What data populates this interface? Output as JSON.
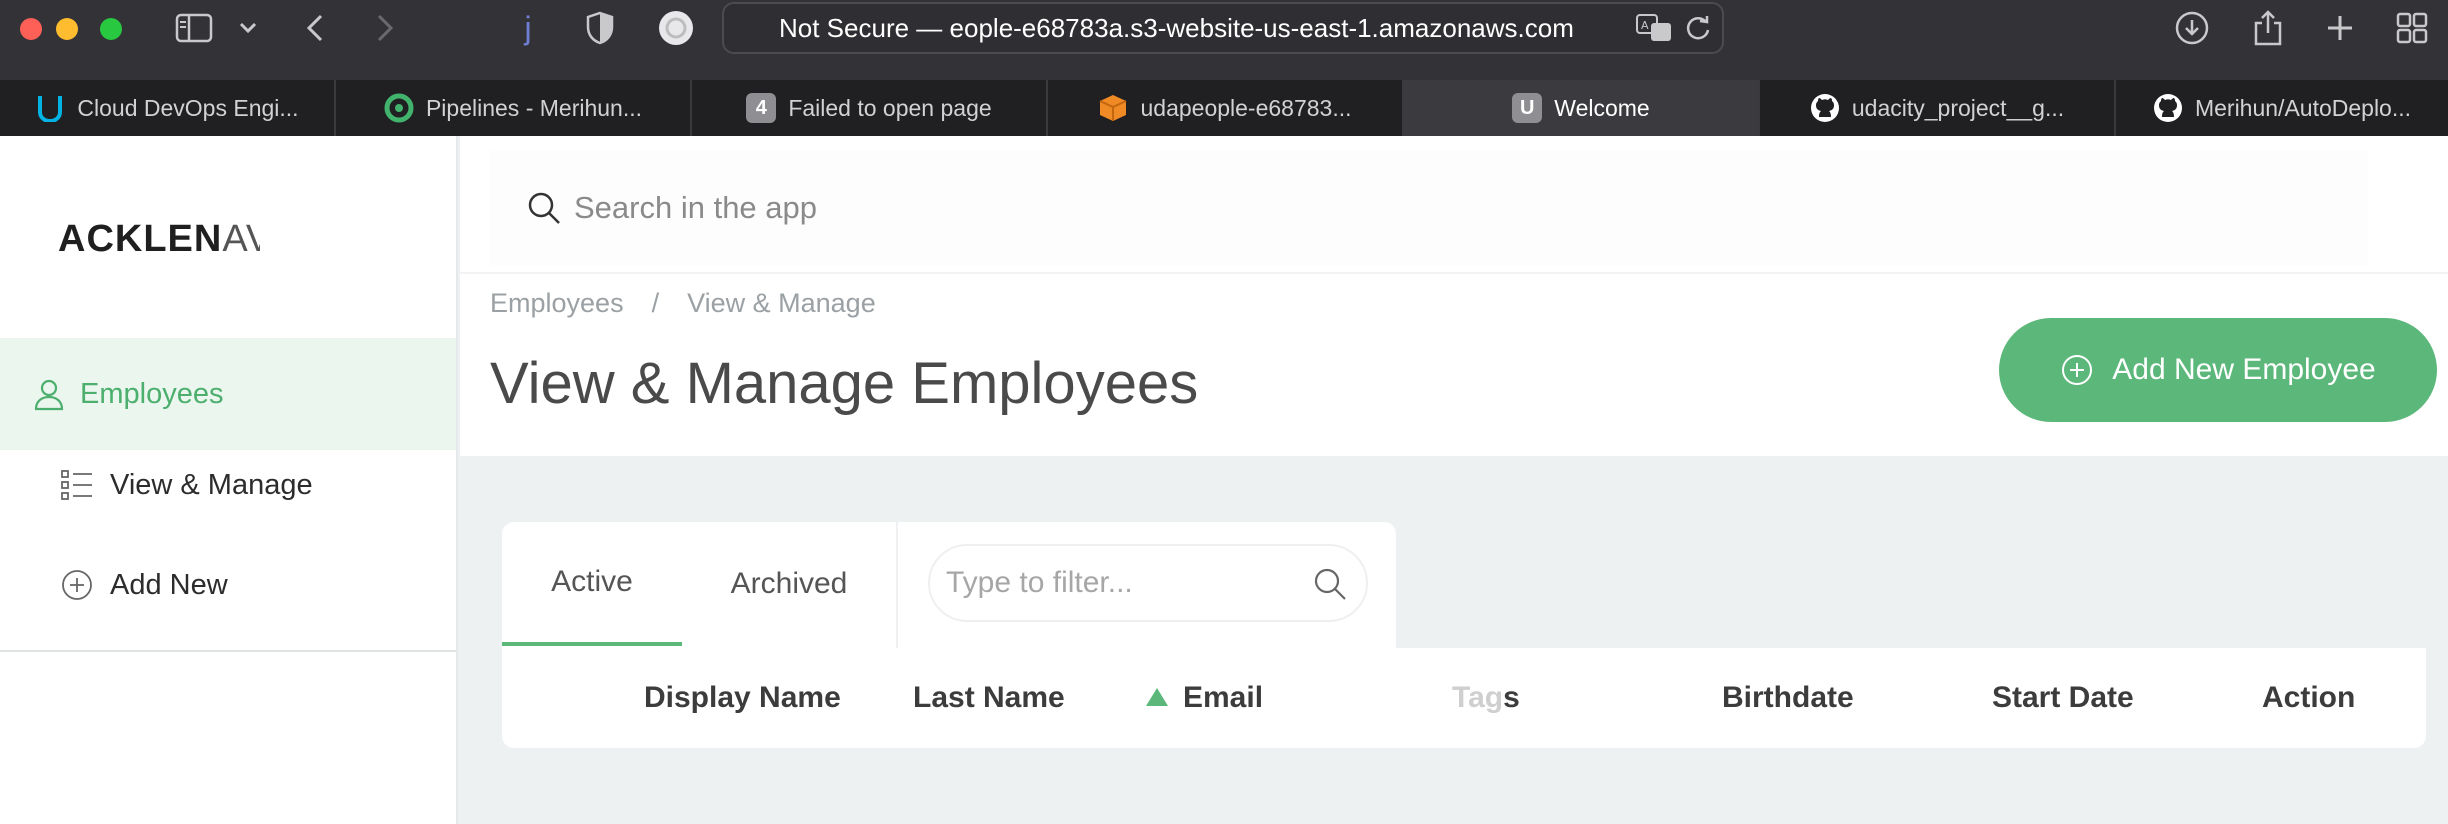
{
  "browser": {
    "address_prefix": "Not Secure —",
    "address_url": "eople-e68783a.s3-website-us-east-1.amazonaws.com",
    "tabs": [
      {
        "label": "Cloud DevOps Engi...",
        "icon": "udacity-icon",
        "favicon_char": "U",
        "color": "#02b3e4"
      },
      {
        "label": "Pipelines - Merihun...",
        "icon": "circleci-icon",
        "favicon_char": "",
        "color": "#41b36c"
      },
      {
        "label": "Failed to open page",
        "icon": "number-badge-icon",
        "favicon_char": "4",
        "color": "#8e8e93"
      },
      {
        "label": "udapeople-e68783...",
        "icon": "aws-box-icon",
        "favicon_char": "",
        "color": "#f08a24"
      },
      {
        "label": "Welcome",
        "icon": "app-letter-icon",
        "favicon_char": "U",
        "color": "#8e8e93",
        "active": true
      },
      {
        "label": "udacity_project__g...",
        "icon": "github-icon",
        "favicon_char": "",
        "color": "#ffffff"
      },
      {
        "label": "Merihun/AutoDeplo...",
        "icon": "github-icon",
        "favicon_char": "",
        "color": "#ffffff"
      }
    ]
  },
  "sidebar": {
    "logo_bold": "ACKLEN",
    "logo_thin": "AVENUE",
    "nav": {
      "employees": "Employees",
      "view_manage": "View & Manage",
      "add_new": "Add New"
    }
  },
  "header": {
    "search_placeholder": "Search in the app",
    "breadcrumb": [
      "Employees",
      "/",
      "View & Manage"
    ],
    "title": "View & Manage Employees",
    "add_button": "Add New Employee"
  },
  "list": {
    "tabs": {
      "active": "Active",
      "archived": "Archived"
    },
    "filter_placeholder": "Type to filter...",
    "columns": {
      "display_name": "Display Name",
      "last_name": "Last Name",
      "email": "Email",
      "tags_faint": "Tag",
      "tags_end": "s",
      "birthdate": "Birthdate",
      "start_date": "Start Date",
      "action": "Action"
    },
    "sorted_column": "email",
    "sort_direction": "ascending"
  },
  "colors": {
    "accent": "#5cb87a",
    "titlebar": "#333236",
    "tabstrip": "#202023"
  }
}
